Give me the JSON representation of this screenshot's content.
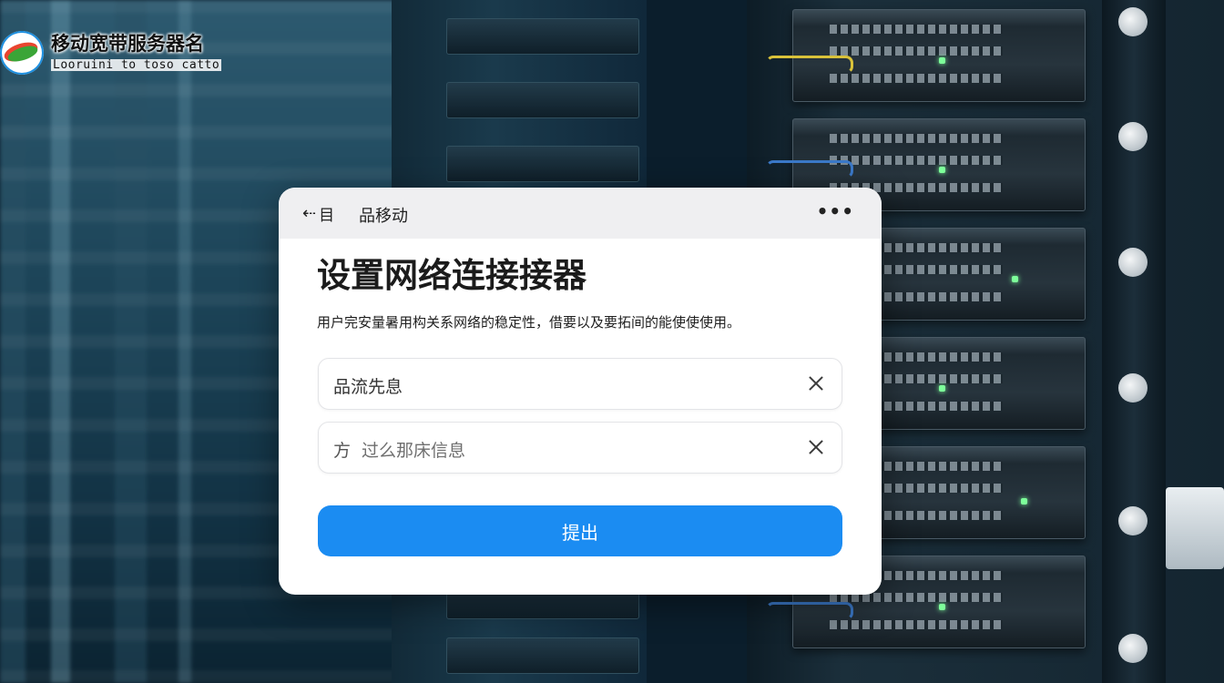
{
  "logo": {
    "title": "移动宽带服务器名",
    "subtitle": "Looruini to toso catto",
    "icon": "brand-leaf-icon"
  },
  "dialog": {
    "back_label": "目",
    "back_icon": "back-arrow-icon",
    "bar_title": "品移动",
    "more_icon": "more-dots-icon",
    "more_label": "•••",
    "title": "设置网络连接接器",
    "description": "用户完安量暑用构关系网络的稳定性，借要以及要拓间的能使使使用。",
    "fields": [
      {
        "value": "品流先息",
        "prefix": "",
        "clear_icon": "close-icon"
      },
      {
        "value": "过么那床信息",
        "prefix": "方",
        "clear_icon": "close-icon"
      }
    ],
    "submit_label": "提出"
  },
  "colors": {
    "accent": "#1b8cf2",
    "card_bar": "#efeff1",
    "led": "#7dff9a",
    "cable_yellow": "#d9c23a",
    "cable_blue": "#3b79c9"
  }
}
